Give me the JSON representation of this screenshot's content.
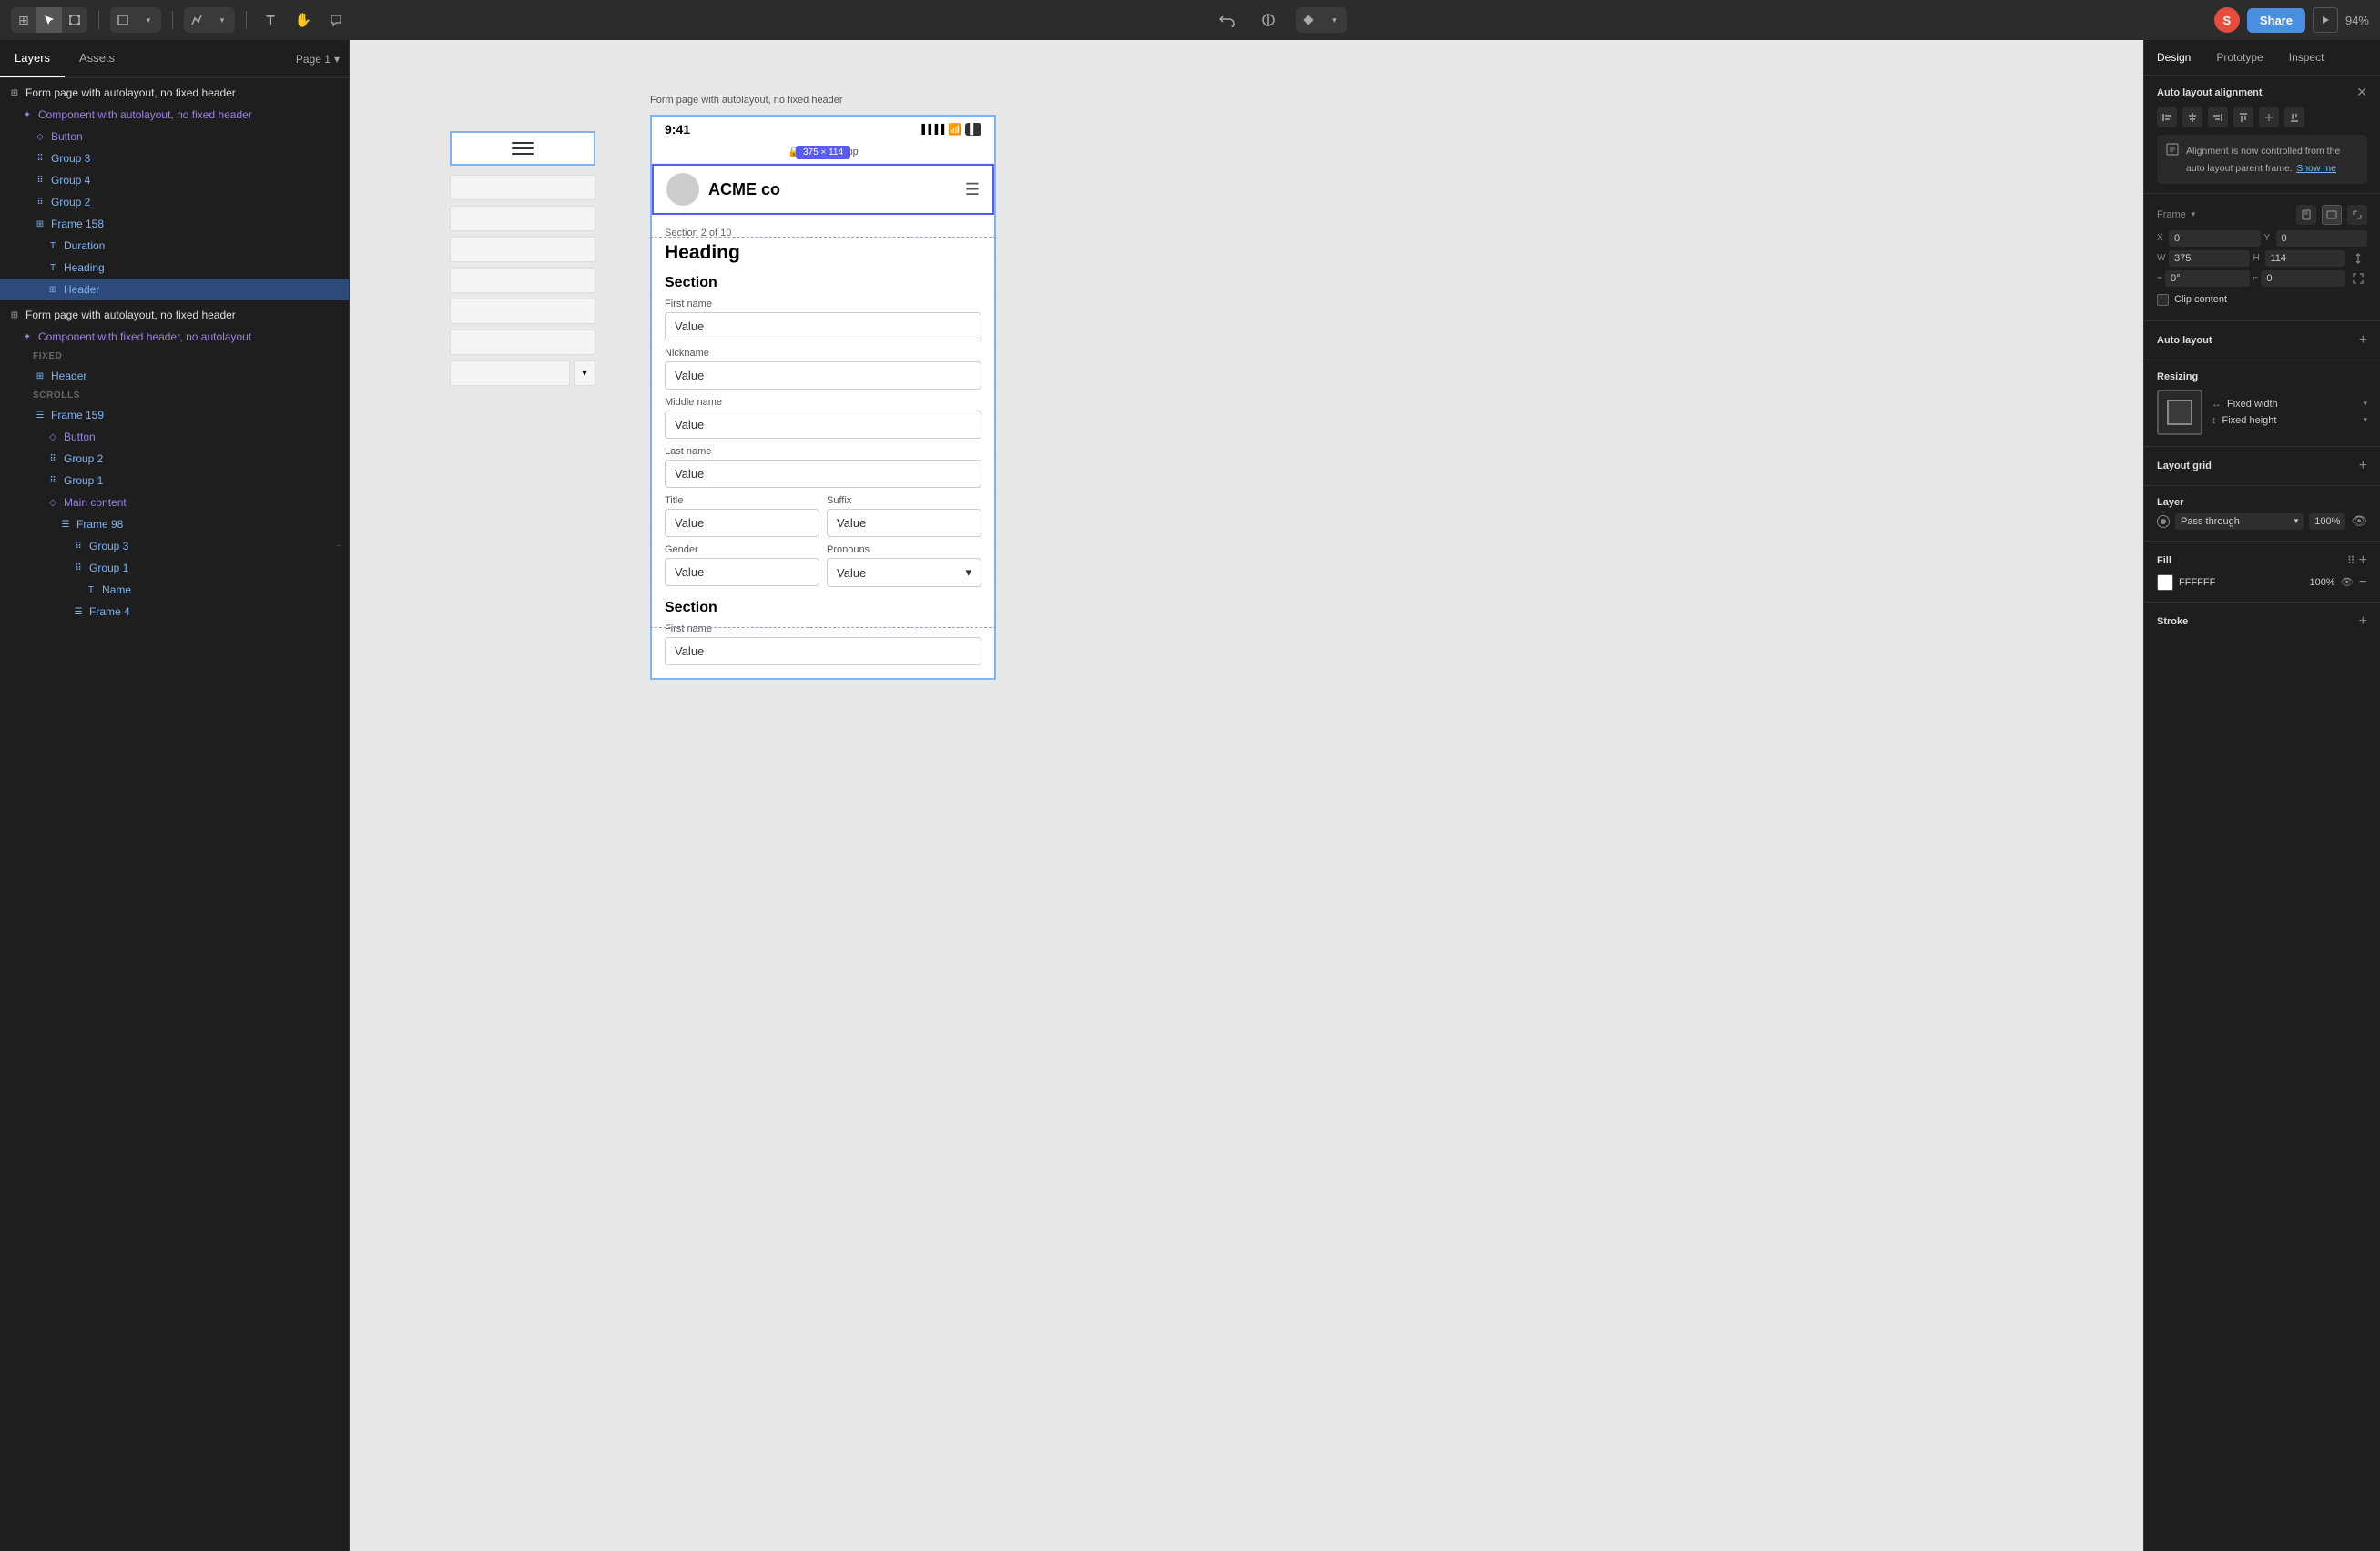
{
  "toolbar": {
    "tools": [
      "⊞",
      "→",
      "⊞",
      "□",
      "✏",
      "T",
      "✋",
      "○"
    ],
    "share_label": "Share",
    "zoom_label": "94%",
    "avatar_initial": "S"
  },
  "left_panel": {
    "tabs": [
      "Layers",
      "Assets"
    ],
    "page_label": "Page 1",
    "tree": [
      {
        "id": 1,
        "indent": 0,
        "icon": "frame",
        "label": "Form page with autolayout, no fixed header",
        "type": "frame",
        "color": "normal"
      },
      {
        "id": 2,
        "indent": 1,
        "icon": "component",
        "label": "Component with autolayout, no fixed header",
        "type": "component",
        "color": "purple"
      },
      {
        "id": 3,
        "indent": 2,
        "icon": "diamond",
        "label": "Button",
        "type": "instance",
        "color": "purple"
      },
      {
        "id": 4,
        "indent": 2,
        "icon": "grid",
        "label": "Group 3",
        "type": "group",
        "color": "blue"
      },
      {
        "id": 5,
        "indent": 2,
        "icon": "grid",
        "label": "Group 4",
        "type": "group",
        "color": "blue"
      },
      {
        "id": 6,
        "indent": 2,
        "icon": "grid",
        "label": "Group 2",
        "type": "group",
        "color": "blue"
      },
      {
        "id": 7,
        "indent": 2,
        "icon": "frame",
        "label": "Frame 158",
        "type": "frame",
        "color": "blue"
      },
      {
        "id": 8,
        "indent": 3,
        "icon": "text",
        "label": "Duration",
        "type": "text",
        "color": "blue"
      },
      {
        "id": 9,
        "indent": 3,
        "icon": "text",
        "label": "Heading",
        "type": "text",
        "color": "blue"
      },
      {
        "id": 10,
        "indent": 3,
        "icon": "frame",
        "label": "Header",
        "type": "frame",
        "color": "blue",
        "selected": true
      },
      {
        "id": 11,
        "indent": 0,
        "icon": "frame",
        "label": "Form page with autolayout, no fixed header",
        "type": "frame",
        "color": "normal"
      },
      {
        "id": 12,
        "indent": 1,
        "icon": "component",
        "label": "Component with fixed header, no autolayout",
        "type": "component",
        "color": "purple"
      },
      {
        "id": 13,
        "indent": 2,
        "icon": "section-label",
        "label": "FIXED",
        "type": "section_label",
        "color": "normal"
      },
      {
        "id": 14,
        "indent": 2,
        "icon": "frame",
        "label": "Header",
        "type": "frame",
        "color": "blue"
      },
      {
        "id": 15,
        "indent": 2,
        "icon": "section-label",
        "label": "SCROLLS",
        "type": "section_label",
        "color": "normal"
      },
      {
        "id": 16,
        "indent": 2,
        "icon": "frame-list",
        "label": "Frame 159",
        "type": "frame",
        "color": "blue"
      },
      {
        "id": 17,
        "indent": 3,
        "icon": "diamond",
        "label": "Button",
        "type": "instance",
        "color": "purple"
      },
      {
        "id": 18,
        "indent": 3,
        "icon": "grid",
        "label": "Group 2",
        "type": "group",
        "color": "blue"
      },
      {
        "id": 19,
        "indent": 3,
        "icon": "grid",
        "label": "Group 1",
        "type": "group",
        "color": "blue"
      },
      {
        "id": 20,
        "indent": 3,
        "icon": "diamond",
        "label": "Main content",
        "type": "instance",
        "color": "purple"
      },
      {
        "id": 21,
        "indent": 4,
        "icon": "frame-list",
        "label": "Frame 98",
        "type": "frame",
        "color": "blue"
      },
      {
        "id": 22,
        "indent": 5,
        "icon": "grid",
        "label": "Group 3",
        "type": "group",
        "color": "blue"
      },
      {
        "id": 23,
        "indent": 5,
        "icon": "grid",
        "label": "Group 1",
        "type": "group",
        "color": "blue"
      },
      {
        "id": 24,
        "indent": 6,
        "icon": "text",
        "label": "Name",
        "type": "text",
        "color": "blue"
      },
      {
        "id": 25,
        "indent": 5,
        "icon": "frame-list",
        "label": "Frame 4",
        "type": "frame",
        "color": "blue"
      }
    ]
  },
  "canvas": {
    "frame_label": "Form page with autolayout, no fixed header",
    "selection_badge": "375 × 114",
    "phone": {
      "status_time": "9:41",
      "nav_url": "acmeco.app",
      "company_name": "ACME co",
      "section_num": "Section 2 of 10",
      "heading": "Heading",
      "section_title": "Section",
      "fields": [
        {
          "label": "First name",
          "value": "Value"
        },
        {
          "label": "Nickname",
          "value": "Value"
        },
        {
          "label": "Middle name",
          "value": "Value"
        },
        {
          "label": "Last name",
          "value": "Value"
        }
      ],
      "row_fields": [
        {
          "label": "Title",
          "value": "Value"
        },
        {
          "label": "Suffix",
          "value": "Value"
        }
      ],
      "row_fields2": [
        {
          "label": "Gender",
          "value": "Value"
        },
        {
          "label": "Pronouns",
          "value": "Value"
        }
      ],
      "section2_title": "Section",
      "section2_first_label": "First name",
      "section2_first_value": "Value"
    }
  },
  "right_panel": {
    "tabs": [
      "Design",
      "Prototype",
      "Inspect"
    ],
    "active_tab": "Design",
    "alignment": {
      "title": "Auto layout alignment",
      "info_text": "Alignment is now controlled from the auto layout parent frame.",
      "info_link": "Show me"
    },
    "frame": {
      "label": "Frame",
      "x_label": "X",
      "x_value": "0",
      "y_label": "Y",
      "y_value": "0",
      "w_label": "W",
      "w_value": "375",
      "h_label": "H",
      "h_value": "114",
      "angle_value": "0°",
      "corner_value": "0"
    },
    "clip_content_label": "Clip content",
    "auto_layout_label": "Auto layout",
    "resizing": {
      "title": "Resizing",
      "fixed_width": "Fixed width",
      "fixed_height": "Fixed height"
    },
    "layout_grid": {
      "title": "Layout grid"
    },
    "layer": {
      "title": "Layer",
      "blend_mode": "Pass through",
      "opacity": "100%"
    },
    "fill": {
      "title": "Fill",
      "color": "FFFFFF",
      "opacity": "100%"
    },
    "stroke": {
      "title": "Stroke"
    }
  }
}
